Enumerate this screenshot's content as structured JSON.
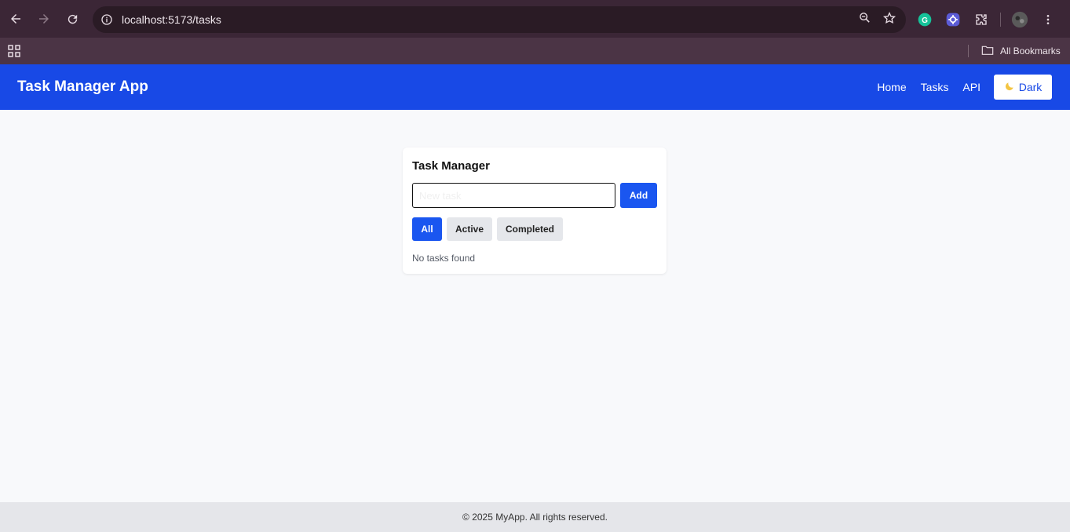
{
  "browser": {
    "url": "localhost:5173/tasks",
    "bookmarks_label": "All Bookmarks",
    "icons": [
      "back-icon",
      "forward-icon",
      "reload-icon",
      "info-icon",
      "zoom-icon",
      "star-icon",
      "grammarly-icon",
      "extension-icon",
      "puzzle-icon",
      "avatar",
      "menu-icon",
      "apps-icon",
      "folder-icon"
    ]
  },
  "header": {
    "brand": "Task Manager App",
    "nav": [
      "Home",
      "Tasks",
      "API"
    ],
    "theme_button": "Dark",
    "theme_icon": "moon-icon",
    "color": "#1849e6"
  },
  "card": {
    "title": "Task Manager",
    "input_placeholder": "New task",
    "input_value": "",
    "add_label": "Add",
    "filters": [
      "All",
      "Active",
      "Completed"
    ],
    "active_filter": "All",
    "empty_message": "No tasks found"
  },
  "footer": {
    "text": "© 2025 MyApp. All rights reserved."
  },
  "colors": {
    "accent": "#1a56f0",
    "chrome": "#3b2636"
  }
}
